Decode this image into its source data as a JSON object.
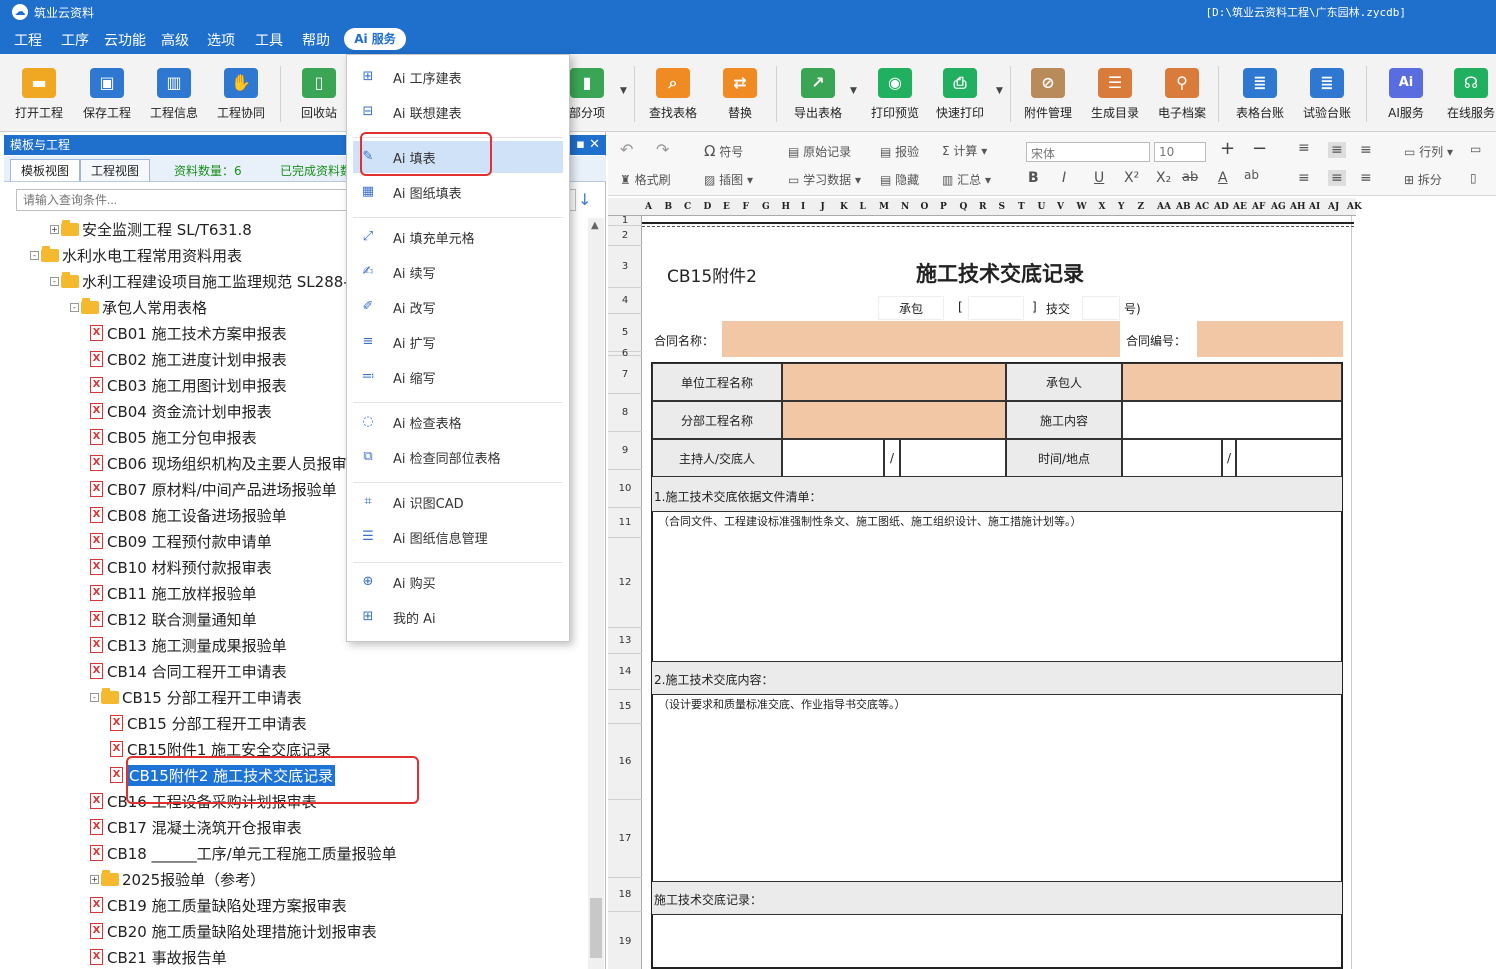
{
  "app": {
    "title": "筑业云资料",
    "path": "[D:\\筑业云资料工程\\广东园林.zycdb]"
  },
  "menu": [
    "工程",
    "工序",
    "云功能",
    "高级",
    "选项",
    "工具",
    "帮助"
  ],
  "ai_menu_label": "Ai 服务",
  "toolbar": {
    "left": [
      {
        "label": "打开工程",
        "icon": "folder-open-icon",
        "color": "#f0a822"
      },
      {
        "label": "保存工程",
        "icon": "save-icon",
        "color": "#2f78d1"
      },
      {
        "label": "工程信息",
        "icon": "building-icon",
        "color": "#2f78d1"
      },
      {
        "label": "工程协同",
        "icon": "handshake-icon",
        "color": "#2f78d1"
      },
      {
        "label": "回收站",
        "icon": "trash-icon",
        "color": "#3aa655"
      },
      {
        "label": "部分项",
        "icon": "bar-chart-icon",
        "color": "#3aa655"
      }
    ],
    "right": [
      {
        "label": "查找表格",
        "icon": "search-icon",
        "color": "#f08a22"
      },
      {
        "label": "替换",
        "icon": "replace-icon",
        "color": "#f08a22"
      },
      {
        "label": "导出表格",
        "icon": "export-icon",
        "color": "#3aa655"
      },
      {
        "label": "打印预览",
        "icon": "preview-icon",
        "color": "#20b060"
      },
      {
        "label": "快速打印",
        "icon": "printer-icon",
        "color": "#20b060"
      },
      {
        "label": "附件管理",
        "icon": "attachment-icon",
        "color": "#b98a5a"
      },
      {
        "label": "生成目录",
        "icon": "list-icon",
        "color": "#d97b3a"
      },
      {
        "label": "电子档案",
        "icon": "archive-icon",
        "color": "#d97b3a"
      },
      {
        "label": "表格台账",
        "icon": "ledger-icon",
        "color": "#2f78d1"
      },
      {
        "label": "试验台账",
        "icon": "test-ledger-icon",
        "color": "#2f78d1"
      },
      {
        "label": "AI服务",
        "icon": "ai-icon",
        "color": "#5a6de0"
      },
      {
        "label": "在线服务",
        "icon": "headset-icon",
        "color": "#20b060"
      }
    ]
  },
  "left_panel": {
    "title": "模板与工程",
    "tabs": [
      "模板视图",
      "工程视图"
    ],
    "count": "资料数量：6",
    "done": "已完成资料数",
    "search_placeholder": "请输入查询条件..."
  },
  "tree": [
    {
      "text": "安全监测工程 SL/T631.8",
      "kind": "folder",
      "level": 2,
      "pm": "+"
    },
    {
      "text": "水利水电工程常用资料用表",
      "kind": "folder",
      "level": 1,
      "pm": "-"
    },
    {
      "text": "水利工程建设项目施工监理规范 SL288-2014",
      "kind": "folder",
      "level": 2,
      "pm": "-"
    },
    {
      "text": "承包人常用表格",
      "kind": "folder",
      "level": 3,
      "pm": "-"
    },
    {
      "text": "CB01 施工技术方案申报表",
      "kind": "doc",
      "level": 4
    },
    {
      "text": "CB02 施工进度计划申报表",
      "kind": "doc",
      "level": 4
    },
    {
      "text": "CB03 施工用图计划申报表",
      "kind": "doc",
      "level": 4
    },
    {
      "text": "CB04 资金流计划申报表",
      "kind": "doc",
      "level": 4
    },
    {
      "text": "CB05 施工分包申报表",
      "kind": "doc",
      "level": 4
    },
    {
      "text": "CB06 现场组织机构及主要人员报审表",
      "kind": "doc",
      "level": 4
    },
    {
      "text": "CB07 原材料/中间产品进场报验单",
      "kind": "doc",
      "level": 4
    },
    {
      "text": "CB08 施工设备进场报验单",
      "kind": "doc",
      "level": 4
    },
    {
      "text": "CB09 工程预付款申请单",
      "kind": "doc",
      "level": 4
    },
    {
      "text": "CB10 材料预付款报审表",
      "kind": "doc",
      "level": 4
    },
    {
      "text": "CB11 施工放样报验单",
      "kind": "doc",
      "level": 4
    },
    {
      "text": "CB12 联合测量通知单",
      "kind": "doc",
      "level": 4
    },
    {
      "text": "CB13 施工测量成果报验单",
      "kind": "doc",
      "level": 4
    },
    {
      "text": "CB14 合同工程开工申请表",
      "kind": "doc",
      "level": 4
    },
    {
      "text": "CB15 分部工程开工申请表",
      "kind": "folder",
      "level": 4,
      "pm": "-"
    },
    {
      "text": "CB15 分部工程开工申请表",
      "kind": "doc",
      "level": 5
    },
    {
      "text": "CB15附件1 施工安全交底记录",
      "kind": "doc",
      "level": 5
    },
    {
      "text": "CB15附件2 施工技术交底记录",
      "kind": "doc",
      "level": 5,
      "selected": true
    },
    {
      "text": "CB16 工程设备采购计划报审表",
      "kind": "doc",
      "level": 4
    },
    {
      "text": "CB17 混凝土浇筑开仓报审表",
      "kind": "doc",
      "level": 4
    },
    {
      "text": "CB18 ______工序/单元工程施工质量报验单",
      "kind": "doc",
      "level": 4
    },
    {
      "text": "2025报验单（参考）",
      "kind": "folder",
      "level": 4,
      "pm": "+"
    },
    {
      "text": "CB19 施工质量缺陷处理方案报审表",
      "kind": "doc",
      "level": 4
    },
    {
      "text": "CB20 施工质量缺陷处理措施计划报审表",
      "kind": "doc",
      "level": 4
    },
    {
      "text": "CB21 事故报告单",
      "kind": "doc",
      "level": 4
    }
  ],
  "ai_dropdown": [
    {
      "label": "Ai 工序建表",
      "icon": "table-plus-icon",
      "glyph": "⊞"
    },
    {
      "label": "Ai 联想建表",
      "icon": "table-link-icon",
      "glyph": "⊟"
    },
    {
      "sep": true
    },
    {
      "label": "Ai 填表",
      "icon": "fill-table-icon",
      "glyph": "✎",
      "highlight": true
    },
    {
      "label": "Ai 图纸填表",
      "icon": "drawing-fill-icon",
      "glyph": "▦"
    },
    {
      "sep": true
    },
    {
      "label": "Ai 填充单元格",
      "icon": "fill-cell-icon",
      "glyph": "⤢"
    },
    {
      "label": "Ai 续写",
      "icon": "continue-write-icon",
      "glyph": "✍"
    },
    {
      "label": "Ai 改写",
      "icon": "rewrite-icon",
      "glyph": "✐"
    },
    {
      "label": "Ai 扩写",
      "icon": "expand-icon",
      "glyph": "≡"
    },
    {
      "label": "Ai 缩写",
      "icon": "shrink-icon",
      "glyph": "≕"
    },
    {
      "sep": true
    },
    {
      "label": "Ai 检查表格",
      "icon": "check-table-icon",
      "glyph": "◌"
    },
    {
      "label": "Ai 检查同部位表格",
      "icon": "check-same-icon",
      "glyph": "⧉"
    },
    {
      "sep": true
    },
    {
      "label": "Ai 识图CAD",
      "icon": "cad-icon",
      "glyph": "⌗"
    },
    {
      "label": "Ai 图纸信息管理",
      "icon": "drawing-info-icon",
      "glyph": "☰"
    },
    {
      "sep": true
    },
    {
      "label": "Ai 购买",
      "icon": "cart-icon",
      "glyph": "⊕"
    },
    {
      "label": "我的 Ai",
      "icon": "grid-icon",
      "glyph": "⊞"
    }
  ],
  "format_bar": {
    "symbol": "符号",
    "original": "原始记录",
    "check": "报验",
    "calc": "计算",
    "format_painter": "格式刷",
    "insert_image": "插图",
    "learn": "学习数据",
    "hide": "隐藏",
    "summary": "汇总",
    "font": "宋体",
    "size": "10",
    "rowcol": "行列",
    "split": "拆分"
  },
  "columns": [
    "A",
    "B",
    "C",
    "D",
    "E",
    "F",
    "G",
    "H",
    "I",
    "J",
    "K",
    "L",
    "M",
    "N",
    "O",
    "P",
    "Q",
    "R",
    "S",
    "T",
    "U",
    "V",
    "W",
    "X",
    "Y",
    "Z",
    "AA",
    "AB",
    "AC",
    "AD",
    "AE",
    "AF",
    "AG",
    "AH",
    "AI",
    "AJ",
    "AK"
  ],
  "rows": [
    "1",
    "2",
    "3",
    "4",
    "5",
    "6",
    "7",
    "8",
    "9",
    "10",
    "11",
    "12",
    "13",
    "14",
    "15",
    "16",
    "17",
    "18",
    "19"
  ],
  "form": {
    "code": "CB15附件2",
    "title": "施工技术交底记录",
    "paren_open": "（",
    "contractor_code": "承包",
    "bracket": "[",
    "bracket_close": "]",
    "tech_handover": "技交",
    "number_suffix": "号)",
    "contract_name": "合同名称：",
    "contract_no": "合同编号：",
    "unit_project": "单位工程名称",
    "contractor": "承包人",
    "sub_project": "分部工程名称",
    "construction_content": "施工内容",
    "host": "主持人/交底人",
    "time_place": "时间/地点",
    "slash": "/",
    "s1_title": "1.施工技术交底依据文件清单：",
    "s1_hint": "（合同文件、工程建设标准强制性条文、施工图纸、施工组织设计、施工措施计划等。）",
    "s2_title": "2.施工技术交底内容：",
    "s2_hint": "（设计要求和质量标准交底、作业指导书交底等。）",
    "s3_title": "施工技术交底记录："
  }
}
